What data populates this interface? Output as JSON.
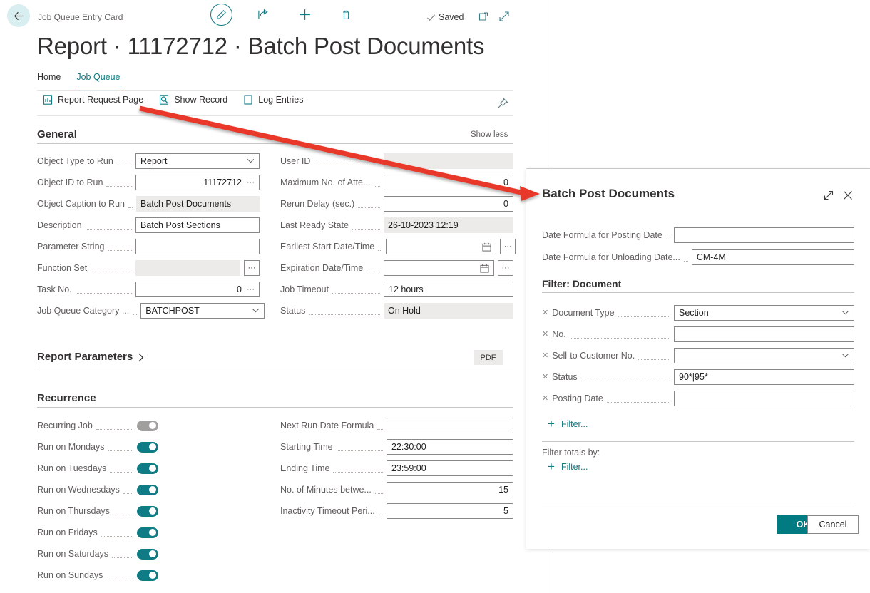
{
  "topbar": {
    "breadcrumb": "Job Queue Entry Card",
    "saved_label": "Saved",
    "icons": {
      "back": "back-arrow-icon",
      "edit": "pencil-icon",
      "share": "share-icon",
      "new": "plus-icon",
      "delete": "trash-icon",
      "open_new_window": "open-in-new-window-icon",
      "fullscreen": "expand-icon"
    }
  },
  "page_title": "Report · 11172712 · Batch Post Documents",
  "tabs": [
    {
      "label": "Home",
      "active": false
    },
    {
      "label": "Job Queue",
      "active": true
    }
  ],
  "actions": [
    {
      "label": "Report Request Page",
      "icon": "report-icon"
    },
    {
      "label": "Show Record",
      "icon": "show-record-icon"
    },
    {
      "label": "Log Entries",
      "icon": "log-entries-icon"
    }
  ],
  "pin_icon": "pin-icon",
  "general": {
    "heading": "General",
    "show_less": "Show less",
    "left_fields": [
      {
        "label": "Object Type to Run",
        "value": "Report",
        "type": "select",
        "readonly": false
      },
      {
        "label": "Object ID to Run",
        "value": "11172712",
        "type": "number-lookup",
        "readonly": false
      },
      {
        "label": "Object Caption to Run",
        "value": "Batch Post Documents",
        "type": "text",
        "readonly": true
      },
      {
        "label": "Description",
        "value": "Batch Post Sections",
        "type": "text",
        "readonly": false
      },
      {
        "label": "Parameter String",
        "value": "",
        "type": "text",
        "readonly": false
      },
      {
        "label": "Function Set",
        "value": "",
        "type": "assist",
        "readonly": true
      },
      {
        "label": "Task No.",
        "value": "0",
        "type": "number-lookup",
        "readonly": false
      },
      {
        "label": "Job Queue Category ...",
        "value": "BATCHPOST",
        "type": "select",
        "readonly": false
      }
    ],
    "right_fields": [
      {
        "label": "User ID",
        "value": "",
        "type": "text",
        "readonly": true
      },
      {
        "label": "Maximum No. of Atte...",
        "value": "0",
        "type": "number",
        "readonly": false
      },
      {
        "label": "Rerun Delay (sec.)",
        "value": "0",
        "type": "number",
        "readonly": false
      },
      {
        "label": "Last Ready State",
        "value": "26-10-2023 12:19",
        "type": "text",
        "readonly": true
      },
      {
        "label": "Earliest Start Date/Time",
        "value": "",
        "type": "datetime",
        "readonly": false
      },
      {
        "label": "Expiration Date/Time",
        "value": "",
        "type": "datetime",
        "readonly": false
      },
      {
        "label": "Job Timeout",
        "value": "12 hours",
        "type": "text",
        "readonly": false
      },
      {
        "label": "Status",
        "value": "On Hold",
        "type": "text",
        "readonly": true
      }
    ]
  },
  "report_parameters": {
    "heading": "Report Parameters",
    "chevron": "chevron-right-icon",
    "format_badge": "PDF"
  },
  "recurrence": {
    "heading": "Recurrence",
    "toggles": [
      {
        "label": "Recurring Job",
        "state": "off"
      },
      {
        "label": "Run on Mondays",
        "state": "on"
      },
      {
        "label": "Run on Tuesdays",
        "state": "on"
      },
      {
        "label": "Run on Wednesdays",
        "state": "on"
      },
      {
        "label": "Run on Thursdays",
        "state": "on"
      },
      {
        "label": "Run on Fridays",
        "state": "on"
      },
      {
        "label": "Run on Saturdays",
        "state": "on"
      },
      {
        "label": "Run on Sundays",
        "state": "on"
      }
    ],
    "right_fields": [
      {
        "label": "Next Run Date Formula",
        "value": "",
        "type": "text"
      },
      {
        "label": "Starting Time",
        "value": "22:30:00",
        "type": "text"
      },
      {
        "label": "Ending Time",
        "value": "23:59:00",
        "type": "text"
      },
      {
        "label": "No. of Minutes betwe...",
        "value": "15",
        "type": "number"
      },
      {
        "label": "Inactivity Timeout Peri...",
        "value": "5",
        "type": "number"
      }
    ]
  },
  "dialog": {
    "title": "Batch Post Documents",
    "expand_icon": "expand-icon",
    "close_icon": "close-icon",
    "top_fields": [
      {
        "label": "Date Formula for Posting Date",
        "value": "",
        "type": "text"
      },
      {
        "label": "Date Formula for Unloading Date...",
        "value": "CM-4M",
        "type": "text"
      }
    ],
    "filter_section_heading": "Filter: Document",
    "filters": [
      {
        "label": "Document Type",
        "value": "Section",
        "type": "select"
      },
      {
        "label": "No.",
        "value": "",
        "type": "text"
      },
      {
        "label": "Sell-to Customer No.",
        "value": "",
        "type": "select"
      },
      {
        "label": "Status",
        "value": "90*|95*",
        "type": "text"
      },
      {
        "label": "Posting Date",
        "value": "",
        "type": "text"
      }
    ],
    "add_filter_label": "Filter...",
    "filter_totals_label": "Filter totals by:",
    "add_filter_totals_label": "Filter...",
    "ok_label": "OK",
    "cancel_label": "Cancel"
  },
  "colors": {
    "accent": "#0f7b84",
    "ok_button": "#007b82",
    "annotation_arrow": "#e8392a",
    "toggle_off": "#a19f9d"
  }
}
